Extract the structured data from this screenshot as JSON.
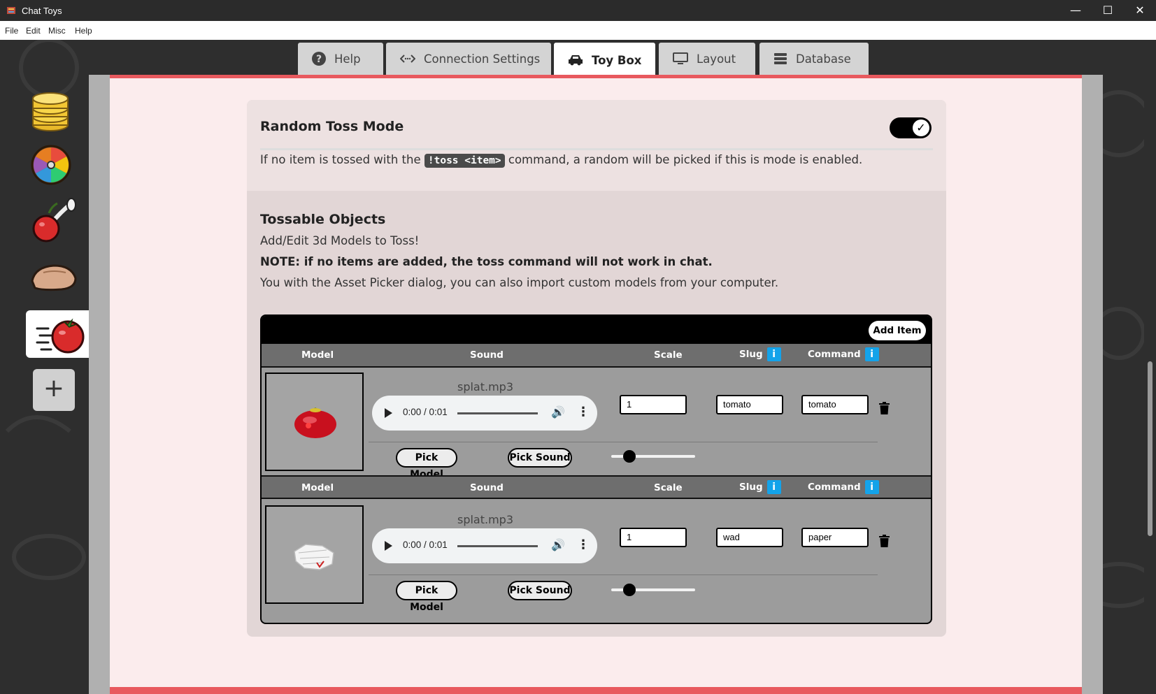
{
  "window": {
    "title": "Chat Toys",
    "minimize": "—",
    "maximize": "☐",
    "close": "✕"
  },
  "menu": {
    "file": "File",
    "edit": "Edit",
    "misc": "Misc",
    "help": "Help"
  },
  "tabs": [
    {
      "label": "Help",
      "icon": "question-circle-icon"
    },
    {
      "label": "Connection Settings",
      "icon": "code-arrows-icon"
    },
    {
      "label": "Toy Box",
      "icon": "car-icon"
    },
    {
      "label": "Layout",
      "icon": "monitor-icon"
    },
    {
      "label": "Database",
      "icon": "database-icon"
    }
  ],
  "active_tab": "Toy Box",
  "sidebar": {
    "items": [
      "coins-icon",
      "wheel-icon",
      "cherry-bomb-icon",
      "hand-icon",
      "tomato-toss-icon"
    ],
    "add_label": "+"
  },
  "random_toss": {
    "title": "Random Toss Mode",
    "enabled": true,
    "desc_pre": "If no item is tossed with the",
    "desc_code": "!toss <item>",
    "desc_post": "command, a random will be picked if this is mode is enabled."
  },
  "tossable": {
    "title": "Tossable Objects",
    "line1": "Add/Edit 3d Models to Toss!",
    "line2": "NOTE: if no items are added, the toss command will not work in chat.",
    "line3": "You with the Asset Picker dialog, you can also import custom models from your computer."
  },
  "table": {
    "add_item": "Add Item",
    "headers": {
      "model": "Model",
      "sound": "Sound",
      "scale": "Scale",
      "slug": "Slug",
      "command": "Command",
      "info": "i"
    },
    "rows": [
      {
        "model": "tomato",
        "sound_file": "splat.mp3",
        "time": "0:00 / 0:01",
        "scale": "1",
        "slug": "tomato",
        "command": "tomato",
        "pick_model": "Pick Model",
        "pick_sound": "Pick Sound",
        "slider_fraction": 0.15
      },
      {
        "model": "paper",
        "sound_file": "splat.mp3",
        "time": "0:00 / 0:01",
        "scale": "1",
        "slug": "wad",
        "command": "paper",
        "pick_model": "Pick Model",
        "pick_sound": "Pick Sound",
        "slider_fraction": 0.15
      }
    ]
  },
  "colors": {
    "accent_red": "#e8595e",
    "info_blue": "#13a3ea",
    "toggle_on": "#000000"
  }
}
